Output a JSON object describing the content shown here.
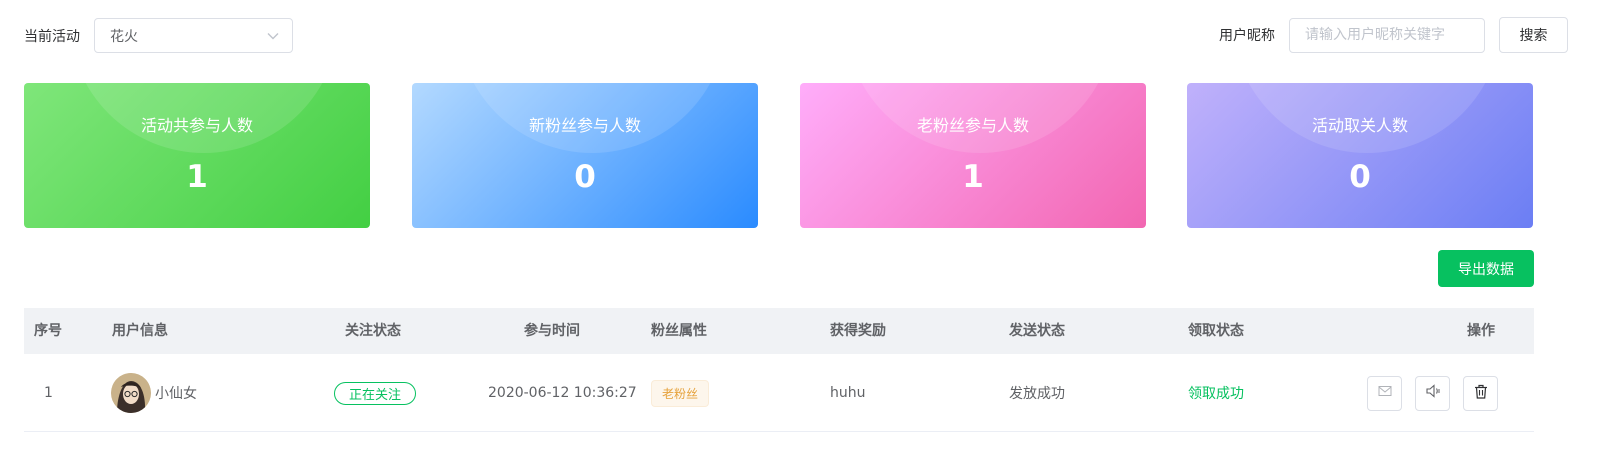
{
  "filter": {
    "activity_label": "当前活动",
    "activity_value": "花火",
    "nickname_label": "用户昵称",
    "nickname_placeholder": "请输入用户昵称关键字",
    "search_label": "搜索"
  },
  "stats": [
    {
      "title": "活动共参与人数",
      "value": "1"
    },
    {
      "title": "新粉丝参与人数",
      "value": "0"
    },
    {
      "title": "老粉丝参与人数",
      "value": "1"
    },
    {
      "title": "活动取关人数",
      "value": "0"
    }
  ],
  "export_label": "导出数据",
  "table": {
    "headers": [
      "序号",
      "用户信息",
      "关注状态",
      "参与时间",
      "粉丝属性",
      "获得奖励",
      "发送状态",
      "领取状态",
      "操作"
    ],
    "rows": [
      {
        "index": "1",
        "nickname": "小仙女",
        "follow_status": "正在关注",
        "join_time": "2020-06-12 10:36:27",
        "fan_type": "老粉丝",
        "reward": "huhu",
        "send_status": "发放成功",
        "receive_status": "领取成功"
      }
    ]
  },
  "icons": {
    "select_arrow": "chevron-down-icon",
    "action_1": "envelope-icon",
    "action_2": "speaker-icon",
    "action_3": "trash-icon"
  },
  "colors": {
    "primary": "#07c160",
    "fan_tag": "#e6a23c"
  }
}
